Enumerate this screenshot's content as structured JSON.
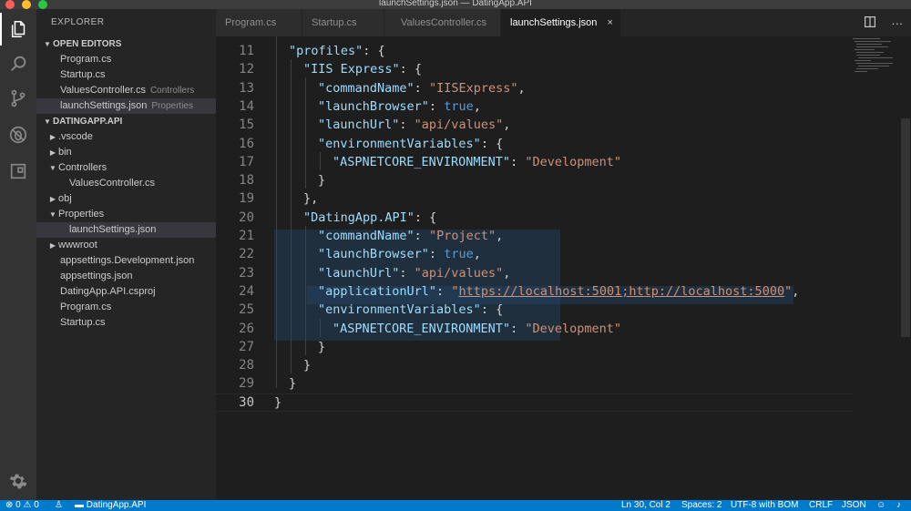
{
  "window": {
    "title": "launchSettings.json — DatingApp.API"
  },
  "sidebar": {
    "header": "EXPLORER",
    "open_editors": {
      "label": "OPEN EDITORS",
      "items": [
        {
          "name": "Program.cs",
          "desc": ""
        },
        {
          "name": "Startup.cs",
          "desc": ""
        },
        {
          "name": "ValuesController.cs",
          "desc": "Controllers"
        },
        {
          "name": "launchSettings.json",
          "desc": "Properties"
        }
      ]
    },
    "project": {
      "label": "DATINGAPP.API",
      "items": [
        {
          "name": ".vscode"
        },
        {
          "name": "bin"
        },
        {
          "name": "Controllers"
        },
        {
          "name": "ValuesController.cs"
        },
        {
          "name": "obj"
        },
        {
          "name": "Properties"
        },
        {
          "name": "launchSettings.json"
        },
        {
          "name": "wwwroot"
        },
        {
          "name": "appsettings.Development.json"
        },
        {
          "name": "appsettings.json"
        },
        {
          "name": "DatingApp.API.csproj"
        },
        {
          "name": "Program.cs"
        },
        {
          "name": "Startup.cs"
        }
      ]
    }
  },
  "tabs": [
    {
      "label": "Program.cs"
    },
    {
      "label": "Startup.cs"
    },
    {
      "label": "ValuesController.cs"
    },
    {
      "label": "launchSettings.json",
      "close": "×"
    }
  ],
  "editor": {
    "line_numbers": [
      "11",
      "12",
      "13",
      "14",
      "15",
      "16",
      "17",
      "18",
      "19",
      "20",
      "21",
      "22",
      "23",
      "24",
      "25",
      "26",
      "27",
      "28",
      "29",
      "30"
    ],
    "code": {
      "l11": {
        "key": "\"profiles\"",
        "rest": ": {"
      },
      "l12": {
        "key": "\"IIS Express\"",
        "rest": ": {"
      },
      "l13": {
        "key": "\"commandName\"",
        "sep": ": ",
        "val": "\"IISExpress\"",
        "end": ","
      },
      "l14": {
        "key": "\"launchBrowser\"",
        "sep": ": ",
        "val": "true",
        "end": ","
      },
      "l15": {
        "key": "\"launchUrl\"",
        "sep": ": ",
        "val": "\"api/values\"",
        "end": ","
      },
      "l16": {
        "key": "\"environmentVariables\"",
        "rest": ": {"
      },
      "l17": {
        "key": "\"ASPNETCORE_ENVIRONMENT\"",
        "sep": ": ",
        "val": "\"Development\""
      },
      "l18": {
        "rest": "}"
      },
      "l19": {
        "rest": "},"
      },
      "l20": {
        "key": "\"DatingApp.API\"",
        "rest": ": {"
      },
      "l21": {
        "key": "\"commandName\"",
        "sep": ": ",
        "val": "\"Project\"",
        "end": ","
      },
      "l22": {
        "key": "\"launchBrowser\"",
        "sep": ": ",
        "val": "true",
        "end": ","
      },
      "l23": {
        "key": "\"launchUrl\"",
        "sep": ": ",
        "val": "\"api/values\"",
        "end": ","
      },
      "l24": {
        "key": "\"applicationUrl\"",
        "sep": ": ",
        "q1": "\"",
        "url": "https://localhost:5001;http://localhost:5000",
        "q2": "\"",
        "end": ","
      },
      "l25": {
        "key": "\"environmentVariables\"",
        "rest": ": {"
      },
      "l26": {
        "key": "\"ASPNETCORE_ENVIRONMENT\"",
        "sep": ": ",
        "val": "\"Development\""
      },
      "l27": {
        "rest": "}"
      },
      "l28": {
        "rest": "}"
      },
      "l29": {
        "rest": "}"
      },
      "l30": {
        "rest": "}"
      }
    },
    "colors": {
      "key": "#9cdcfe",
      "string": "#ce9178",
      "boolean": "#569cd6"
    }
  },
  "statusbar": {
    "errors": "0",
    "warnings": "0",
    "folder": "DatingApp.API",
    "position": "Ln 30, Col 2",
    "spaces": "Spaces: 2",
    "encoding": "UTF-8 with BOM",
    "eol": "CRLF",
    "language": "JSON",
    "accent": "#007acc"
  },
  "icons": [
    "files-icon",
    "search-icon",
    "source-control-icon",
    "debug-icon",
    "extensions-icon",
    "gear-icon",
    "split-editor-icon",
    "more-icon",
    "error-icon",
    "warning-icon",
    "folder-icon",
    "smiley-icon",
    "bell-icon"
  ]
}
